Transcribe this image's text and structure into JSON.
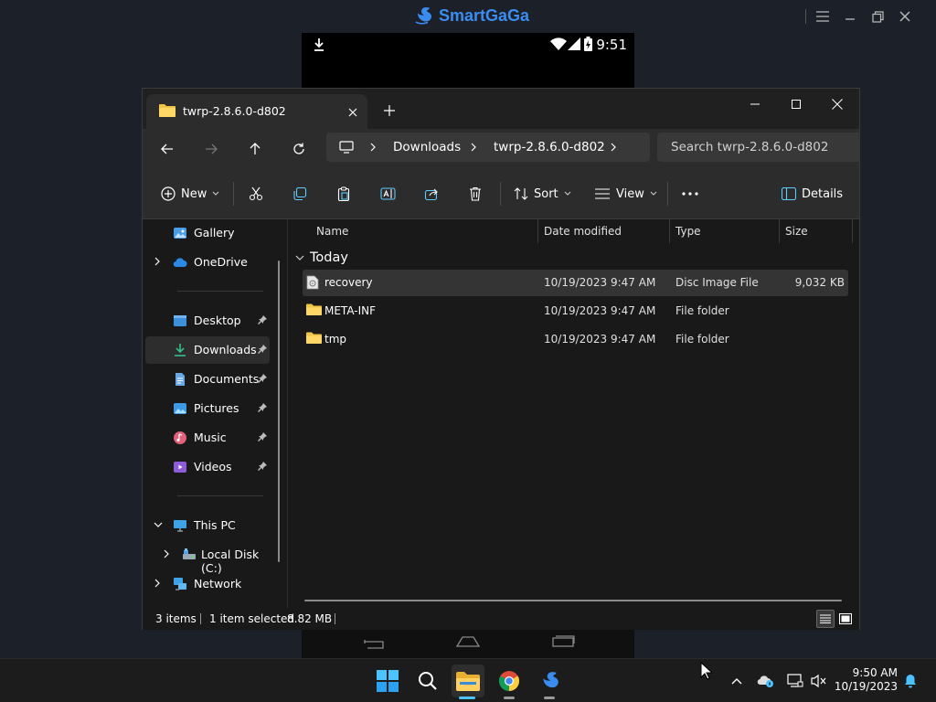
{
  "emulator": {
    "app_name": "SmartGaGa",
    "brand_color": "#3b8cf0"
  },
  "phone": {
    "time": "9:51"
  },
  "explorer": {
    "tab_title": "twrp-2.8.6.0-d802",
    "breadcrumb": [
      "Downloads",
      "twrp-2.8.6.0-d802"
    ],
    "search_placeholder": "Search twrp-2.8.6.0-d802",
    "commands": {
      "new": "New",
      "sort": "Sort",
      "view": "View",
      "details": "Details"
    },
    "sidebar": {
      "gallery": "Gallery",
      "onedrive": "OneDrive",
      "desktop": "Desktop",
      "downloads": "Downloads",
      "documents": "Documents",
      "pictures": "Pictures",
      "music": "Music",
      "videos": "Videos",
      "this_pc": "This PC",
      "local_disk": "Local Disk (C:)",
      "network": "Network"
    },
    "columns": {
      "name": "Name",
      "date": "Date modified",
      "type": "Type",
      "size": "Size"
    },
    "group_label": "Today",
    "files": [
      {
        "name": "recovery",
        "date": "10/19/2023 9:47 AM",
        "type": "Disc Image File",
        "size": "9,032 KB",
        "icon": "disc-image-icon"
      },
      {
        "name": "META-INF",
        "date": "10/19/2023 9:47 AM",
        "type": "File folder",
        "size": "",
        "icon": "folder-icon"
      },
      {
        "name": "tmp",
        "date": "10/19/2023 9:47 AM",
        "type": "File folder",
        "size": "",
        "icon": "folder-icon"
      }
    ],
    "status": {
      "items": "3 items",
      "selected": "1 item selected",
      "selected_size": "8.82 MB"
    }
  },
  "taskbar": {
    "time": "9:50 AM",
    "date": "10/19/2023",
    "accent": "#4cc2ff"
  }
}
